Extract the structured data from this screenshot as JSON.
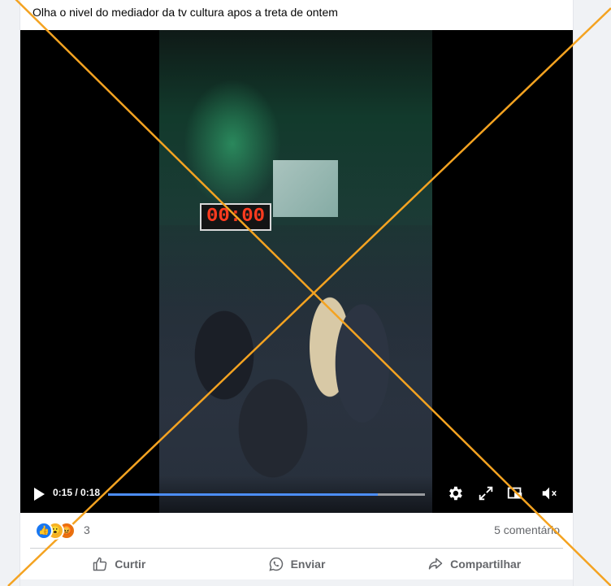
{
  "post": {
    "caption": "Olha o nivel do mediador da tv cultura apos a treta de ontem"
  },
  "video": {
    "scoreboard": "00:00",
    "current_time": "0:15 / 0:18",
    "progress": 0.85,
    "icons": {
      "play": "play-icon",
      "settings": "gear-icon",
      "fullscreen": "fullscreen-icon",
      "pip": "picture-in-picture-icon",
      "volume": "volume-muted-icon"
    }
  },
  "reactions": {
    "types": [
      "like",
      "wow",
      "angry"
    ],
    "count": "3"
  },
  "comments": {
    "label": "5 comentário"
  },
  "actions": {
    "like_label": "Curtir",
    "send_label": "Enviar",
    "share_label": "Compartilhar"
  },
  "colors": {
    "accent": "#1877f2",
    "overlay_x": "#f4a321",
    "progress": "#4c8df6"
  }
}
